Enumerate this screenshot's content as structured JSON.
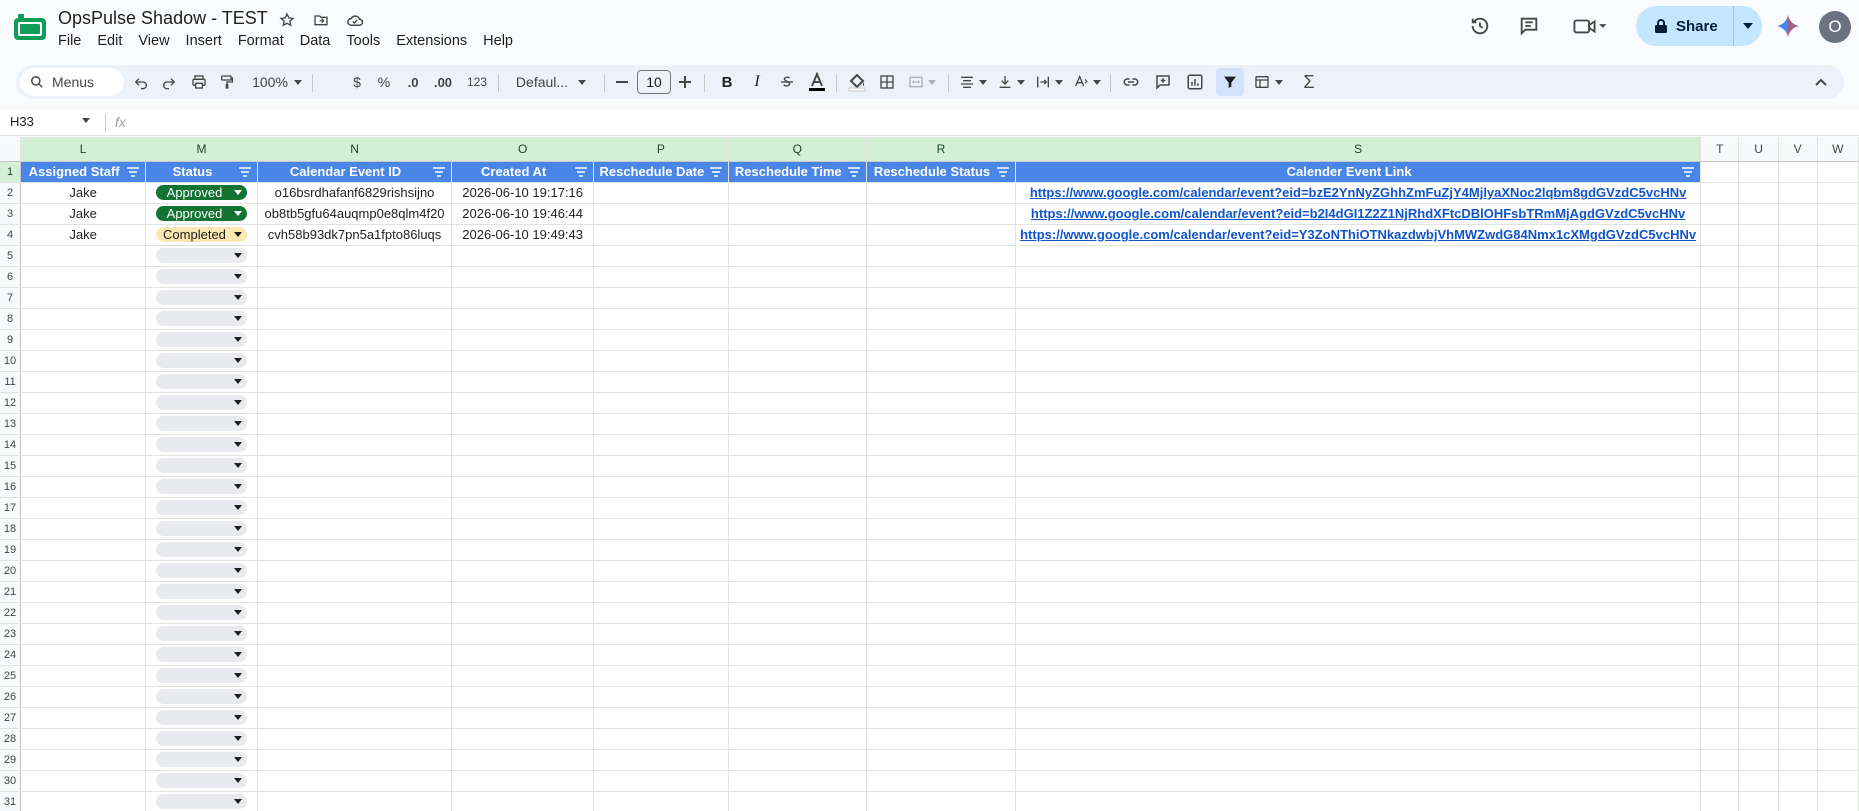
{
  "doc": {
    "title": "OpsPulse Shadow - TEST",
    "menus": [
      "File",
      "Edit",
      "View",
      "Insert",
      "Format",
      "Data",
      "Tools",
      "Extensions",
      "Help"
    ]
  },
  "header": {
    "share_label": "Share",
    "avatar_initial": "O"
  },
  "toolbar": {
    "search_label": "Menus",
    "zoom": "100%",
    "currency": "$",
    "percent": "%",
    "decrease_decimal": ".0",
    "increase_decimal": ".00",
    "number_format": "123",
    "font_family": "Defaul...",
    "font_size": "10"
  },
  "formula_bar": {
    "name_box": "H33",
    "fx": "fx"
  },
  "grid": {
    "columns": [
      "L",
      "M",
      "N",
      "O",
      "P",
      "Q",
      "R",
      "S",
      "T",
      "U",
      "V",
      "W"
    ],
    "selected_columns": [
      "L",
      "M",
      "N",
      "O",
      "P",
      "Q",
      "R",
      "S"
    ],
    "headers": [
      "Assigned Staff",
      "Status",
      "Calendar Event ID",
      "Created At",
      "Reschedule Date",
      "Reschedule Time",
      "Reschedule Status",
      "Calender Event Link"
    ],
    "rows": [
      {
        "staff": "Jake",
        "status": "Approved",
        "event_id": "o16bsrdhafanf6829rishsijno",
        "created": "2026-06-10 19:17:16",
        "link": "https://www.google.com/calendar/event?eid=bzE2YnNyZGhhZmFuZjY4MjlyaXNoc2lqbm8gdGVzdC5vcHNv"
      },
      {
        "staff": "Jake",
        "status": "Approved",
        "event_id": "ob8tb5gfu64auqmp0e8qlm4f20",
        "created": "2026-06-10 19:46:44",
        "link": "https://www.google.com/calendar/event?eid=b2I4dGI1Z2Z1NjRhdXFtcDBlOHFsbTRmMjAgdGVzdC5vcHNv"
      },
      {
        "staff": "Jake",
        "status": "Completed",
        "event_id": "cvh58b93dk7pn5a1fpto86luqs",
        "created": "2026-06-10 19:49:43",
        "link": "https://www.google.com/calendar/event?eid=Y3ZoNThiOTNkazdwbjVhMWZwdG84Nmx1cXMgdGVzdC5vcHNv"
      }
    ],
    "row_numbers": [
      "1",
      "2",
      "3",
      "4",
      "5",
      "6",
      "7",
      "8",
      "9",
      "10",
      "11",
      "12",
      "13",
      "14",
      "15",
      "16",
      "17",
      "18",
      "19",
      "20",
      "21",
      "22",
      "23",
      "24",
      "25",
      "26",
      "27",
      "28",
      "29",
      "30",
      "31"
    ]
  },
  "colors": {
    "header_blue": "#4a86e8",
    "approved_green": "#137333",
    "completed_yellow": "#fce8b2",
    "share_bg": "#c2e7ff",
    "link_blue": "#1155cc"
  },
  "icons": [
    "sheets-logo",
    "star-icon",
    "move-folder-icon",
    "cloud-status-icon",
    "history-icon",
    "comment-icon",
    "meet-icon",
    "lock-icon",
    "gemini-icon",
    "search-icon",
    "undo-icon",
    "redo-icon",
    "print-icon",
    "paint-format-icon",
    "filter-icon",
    "function-icon"
  ]
}
